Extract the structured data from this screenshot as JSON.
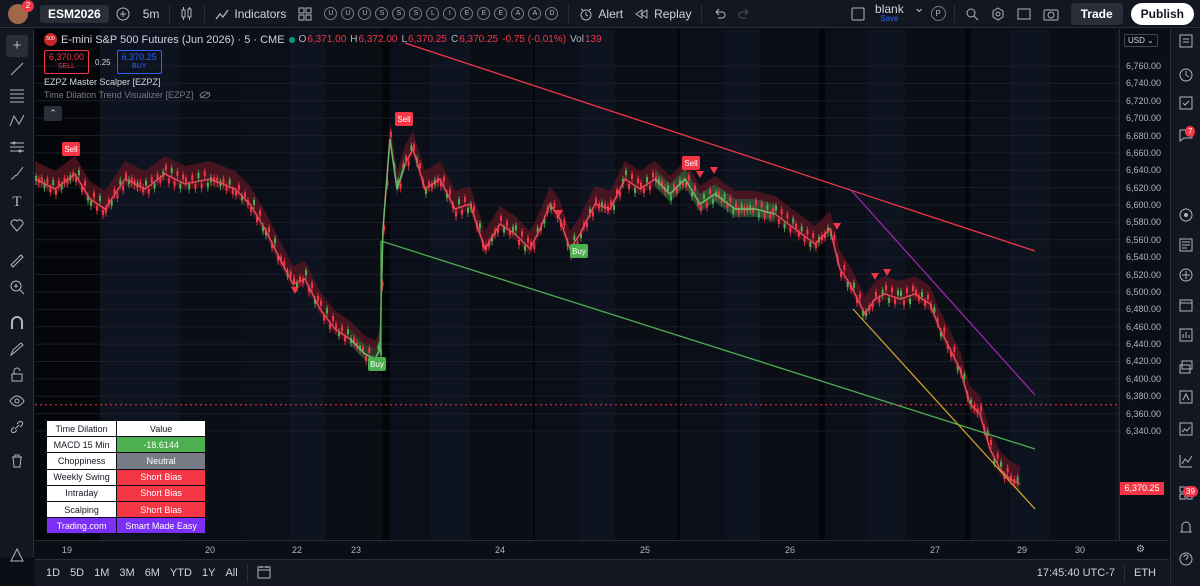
{
  "topbar": {
    "notification_count": "2",
    "symbol": "ESM2026",
    "interval": "5m",
    "indicators_label": "Indicators",
    "quick_markers": [
      "U",
      "U",
      "U",
      "S",
      "S",
      "S",
      "L",
      "I",
      "E",
      "E",
      "E",
      "A",
      "A",
      "D"
    ],
    "alert_label": "Alert",
    "replay_label": "Replay",
    "layout_name": "blank",
    "layout_save": "Save",
    "p_label": "P",
    "trade_label": "Trade",
    "publish_label": "Publish"
  },
  "legend": {
    "symbol_name": "E-mini S&P 500 Futures (Jun 2026) · 5 · CME",
    "logo_text": "500",
    "ohlc": {
      "o_label": "O",
      "o": "6,371.00",
      "h_label": "H",
      "h": "6,372.00",
      "l_label": "L",
      "l": "6,370.25",
      "c_label": "C",
      "c": "6,370.25",
      "change": "-0.75 (-0.01%)",
      "vol_label": "Vol",
      "vol": "139"
    },
    "sell_price": "6,370.00",
    "sell_label": "SELL",
    "spread": "0.25",
    "buy_price": "6,370.25",
    "buy_label": "BUY",
    "indicator1": "EZPZ Master Scalper [EZPZ]",
    "indicator2": "Time Dilation Trend Visualizer [EZPZ]"
  },
  "price_axis": {
    "currency": "USD",
    "ticks": [
      "6,760.00",
      "6,740.00",
      "6,720.00",
      "6,700.00",
      "6,680.00",
      "6,660.00",
      "6,640.00",
      "6,620.00",
      "6,600.00",
      "6,580.00",
      "6,560.00",
      "6,540.00",
      "6,520.00",
      "6,500.00",
      "6,480.00",
      "6,460.00",
      "6,440.00",
      "6,420.00",
      "6,400.00",
      "6,380.00",
      "6,360.00",
      "6,340.00"
    ],
    "current_price": "6,370.25"
  },
  "time_axis": {
    "ticks": [
      "19",
      "20",
      "22",
      "23",
      "24",
      "25",
      "26",
      "27",
      "29",
      "30"
    ]
  },
  "signals": {
    "sell": "Sell",
    "buy": "Buy"
  },
  "table": {
    "headers": [
      "Time Dilation",
      "Value"
    ],
    "rows": [
      {
        "label": "MACD 15 Min",
        "value": "-18.6144",
        "color": "#4caf50"
      },
      {
        "label": "Choppiness",
        "value": "Neutral",
        "color": "#787b86"
      },
      {
        "label": "Weekly Swing",
        "value": "Short Bias",
        "color": "#f23645"
      },
      {
        "label": "Intraday",
        "value": "Short Bias",
        "color": "#f23645"
      },
      {
        "label": "Scalping",
        "value": "Short Bias",
        "color": "#f23645"
      }
    ],
    "footer_brand": "Trading.com",
    "footer_tagline": "Smart Made Easy"
  },
  "bottombar": {
    "ranges": [
      "1D",
      "5D",
      "1M",
      "3M",
      "6M",
      "YTD",
      "1Y",
      "All"
    ],
    "time": "17:45:40 UTC-7",
    "session": "ETH"
  },
  "right_badges": {
    "alerts": "7",
    "notifications": "39"
  },
  "colors": {
    "up": "#4caf50",
    "down": "#f23645",
    "accent": "#2962ff",
    "purple": "#7b2ff7"
  }
}
